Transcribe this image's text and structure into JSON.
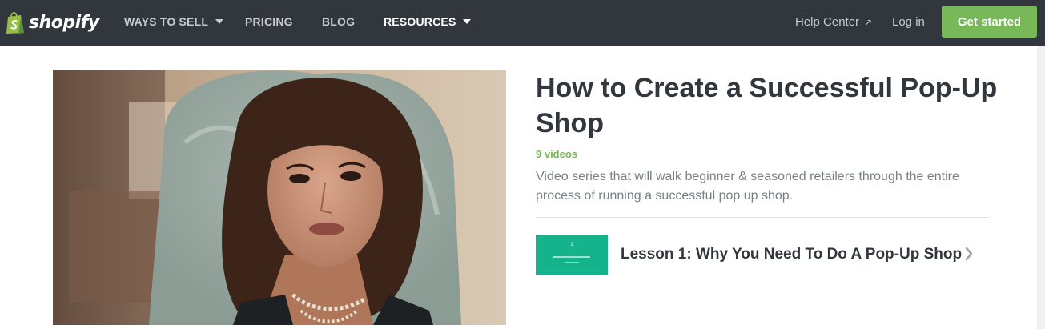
{
  "brand": {
    "name": "shopify",
    "logo_icon": "shopping-bag-icon",
    "logo_color": "#95bf47"
  },
  "nav": {
    "items": [
      {
        "label": "WAYS TO SELL",
        "has_dropdown": true,
        "active": false
      },
      {
        "label": "PRICING",
        "has_dropdown": false,
        "active": false
      },
      {
        "label": "BLOG",
        "has_dropdown": false,
        "active": false
      },
      {
        "label": "RESOURCES",
        "has_dropdown": true,
        "active": true
      }
    ],
    "help_center": "Help Center",
    "help_center_icon": "external-link-icon",
    "external_glyph": "↗",
    "login": "Log in",
    "cta": "Get started"
  },
  "colors": {
    "nav_bg": "#31373d",
    "accent_green": "#79b859",
    "lesson_thumb": "#15b38c",
    "heading": "#31373d",
    "body_text": "#7b7f85"
  },
  "series": {
    "title": "How to Create a Successful Pop-Up Shop",
    "video_count": "9 videos",
    "description": "Video series that will walk beginner & seasoned retailers through the entire process of running a successful pop up shop.",
    "hero_image": "woman-speaking-video-thumbnail"
  },
  "lessons": [
    {
      "title": "Lesson 1: Why You Need To Do A Pop-Up Shop",
      "thumb_text": "1",
      "icon": "chevron-right-icon"
    }
  ]
}
